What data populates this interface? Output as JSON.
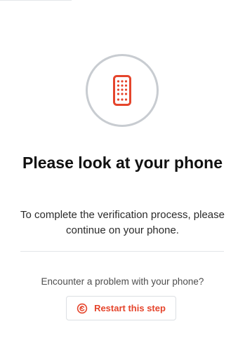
{
  "content": {
    "title": "Please look at your phone",
    "description": "To complete the verification process, please continue on your phone.",
    "problem_prompt": "Encounter a problem with your phone?",
    "restart_label": "Restart this step"
  },
  "icons": {
    "phone": "mobile-phone-icon",
    "restart": "restart-icon"
  },
  "colors": {
    "accent": "#e5452c",
    "ring": "#c8ccd1",
    "divider": "#e3e5e8"
  }
}
